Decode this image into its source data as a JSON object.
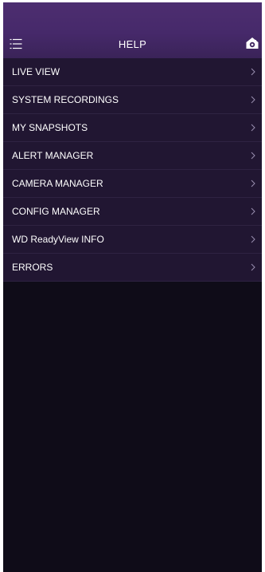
{
  "header": {
    "title": "HELP",
    "menu_icon": "hamburger-menu-icon",
    "home_icon": "home-camera-icon"
  },
  "colors": {
    "header_bg": "#46296a",
    "list_bg": "#211632",
    "page_bg": "#0f0c18",
    "text": "#ffffff"
  },
  "menu": {
    "items": [
      {
        "label": "LIVE VIEW"
      },
      {
        "label": "SYSTEM RECORDINGS"
      },
      {
        "label": "MY SNAPSHOTS"
      },
      {
        "label": "ALERT MANAGER"
      },
      {
        "label": "CAMERA MANAGER"
      },
      {
        "label": "CONFIG MANAGER"
      },
      {
        "label": "WD ReadyView INFO"
      },
      {
        "label": "ERRORS"
      }
    ],
    "chevron_icon": "chevron-right-icon"
  }
}
